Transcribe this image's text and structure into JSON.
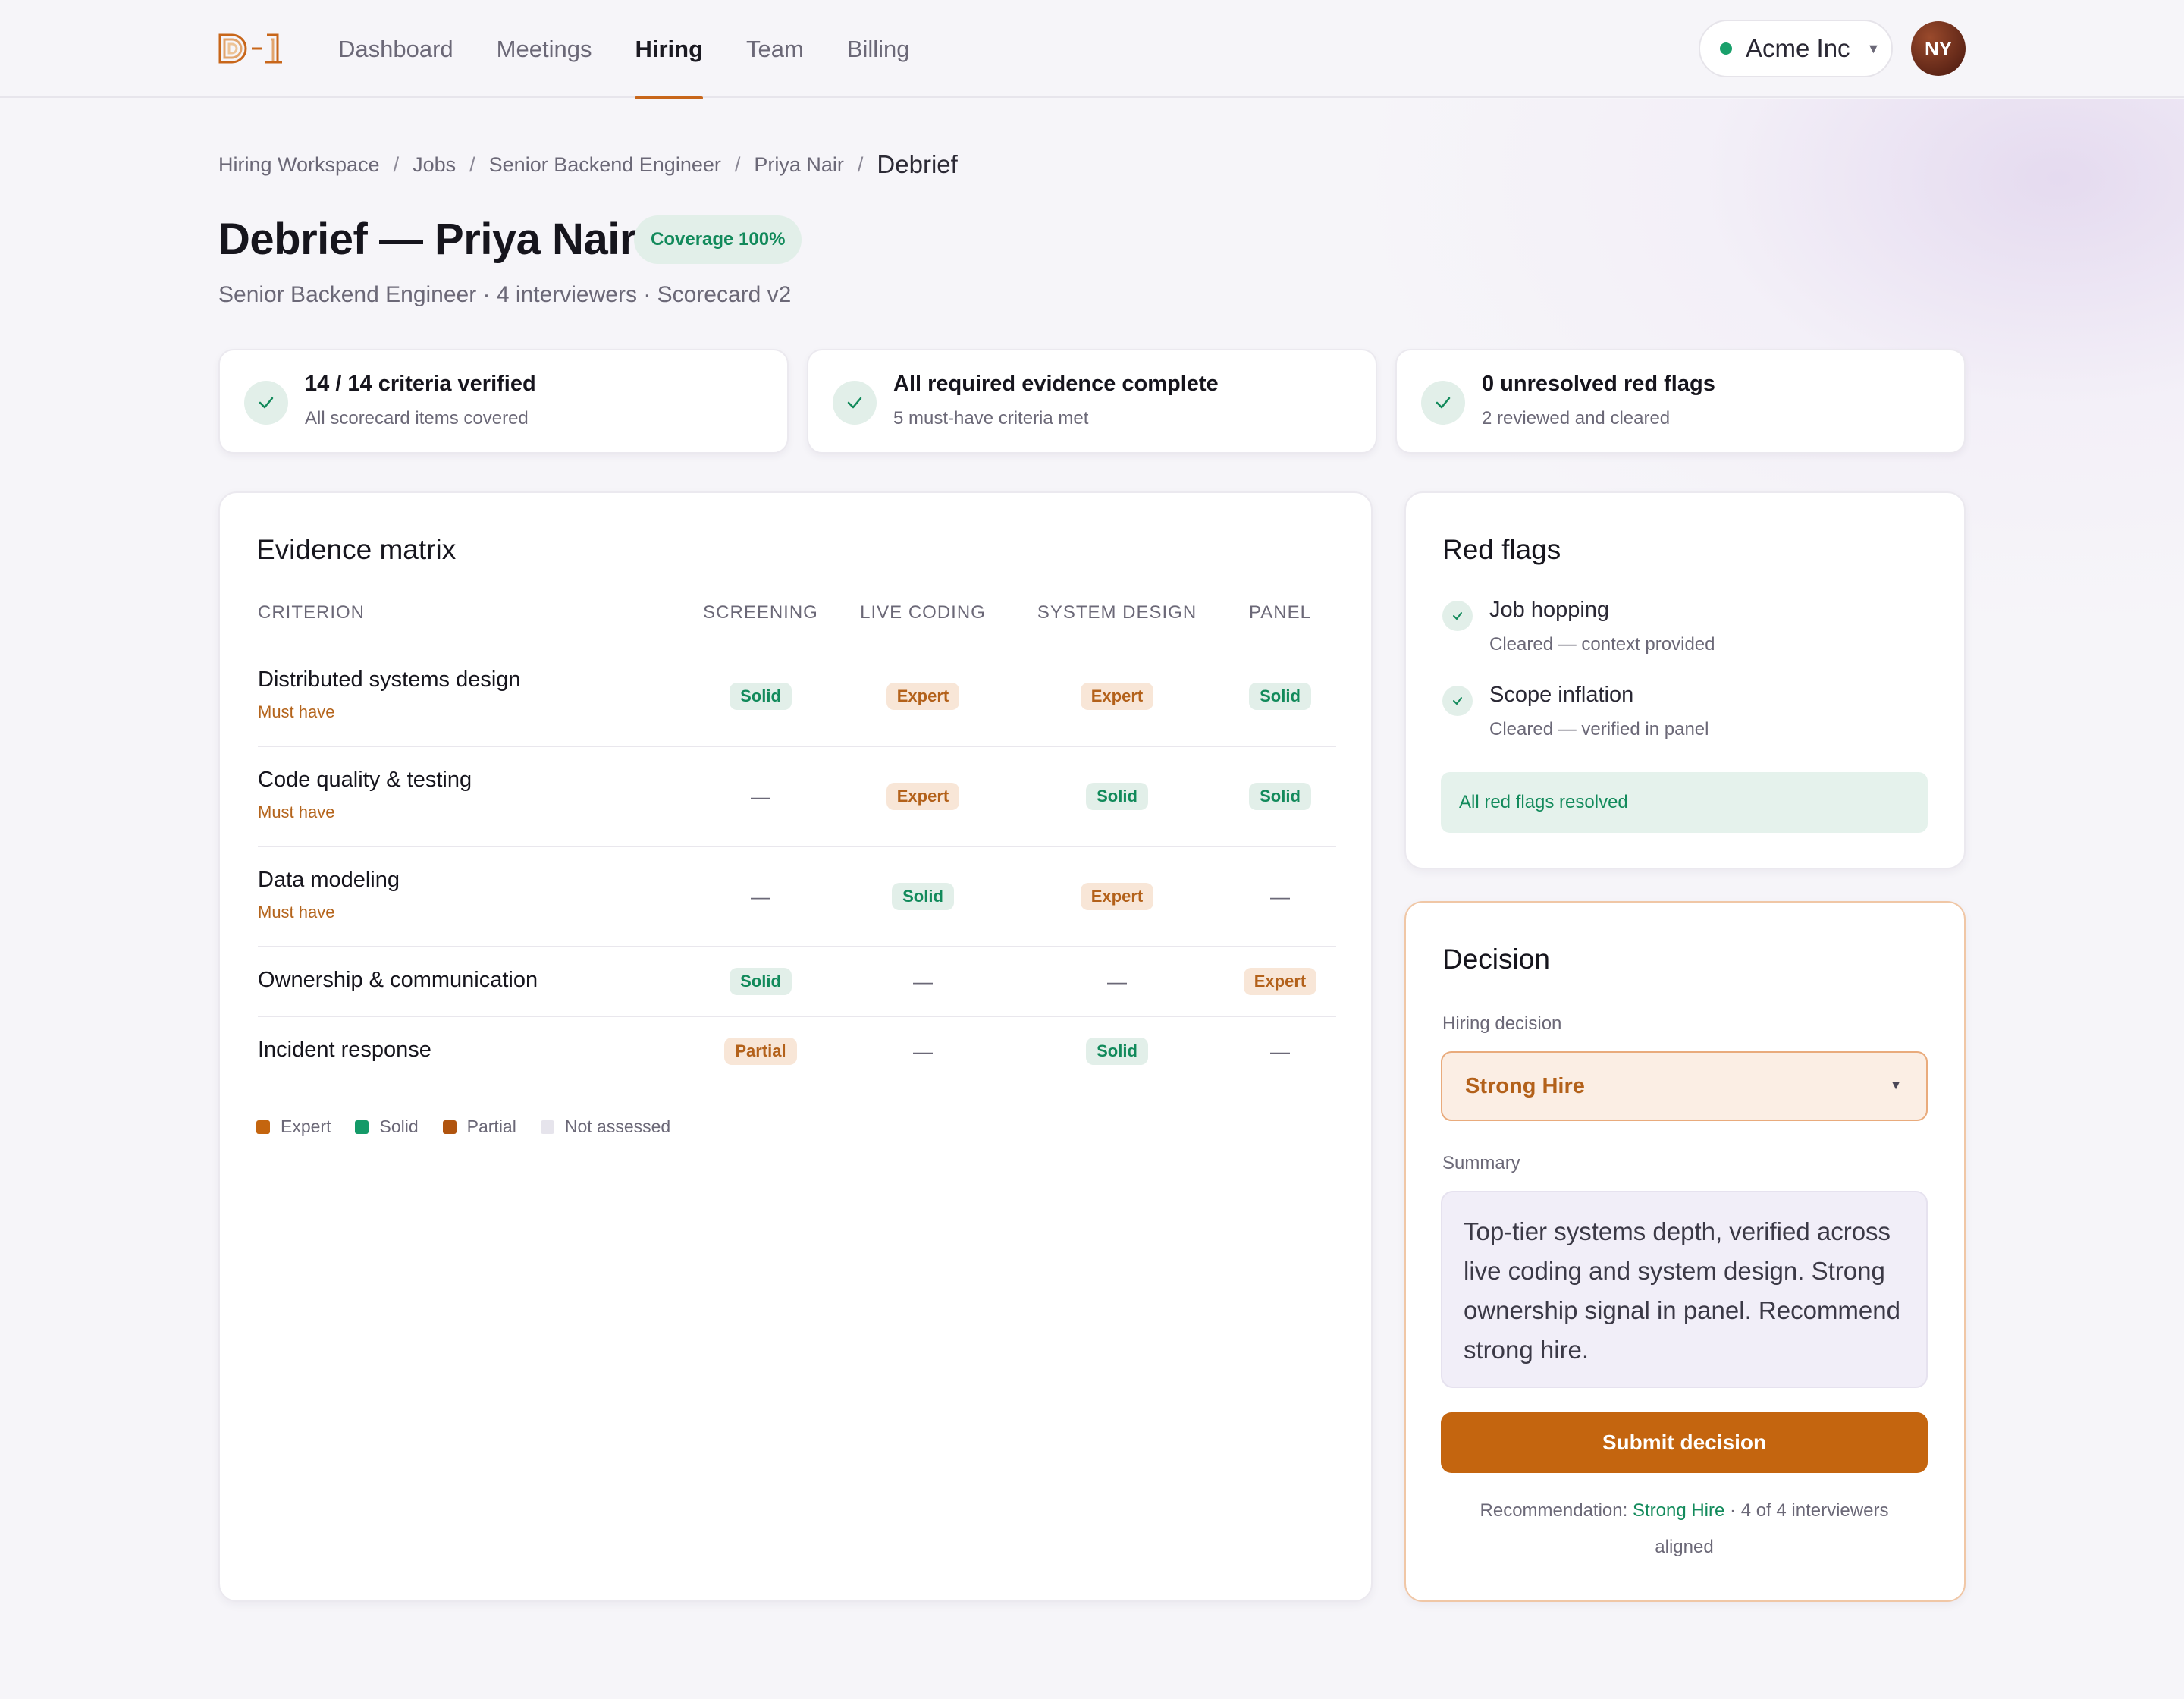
{
  "nav": {
    "logo": "D-1",
    "links": [
      "Dashboard",
      "Meetings",
      "Hiring",
      "Team",
      "Billing"
    ],
    "active": "Hiring",
    "org": "Acme Inc",
    "avatar_initials": "NY"
  },
  "breadcrumb": [
    "Hiring Workspace",
    "Jobs",
    "Senior Backend Engineer",
    "Priya Nair",
    "Debrief"
  ],
  "header": {
    "title": "Debrief — Priya Nair",
    "coverage_badge": "Coverage 100%",
    "subtitle": "Senior Backend Engineer · 4 interviewers · Scorecard v2"
  },
  "stats": [
    {
      "title": "14 / 14 criteria verified",
      "sub": "All scorecard items covered"
    },
    {
      "title": "All required evidence complete",
      "sub": "5 must-have criteria met"
    },
    {
      "title": "0 unresolved red flags",
      "sub": "2 reviewed and cleared"
    }
  ],
  "matrix": {
    "title": "Evidence matrix",
    "columns": [
      "CRITERION",
      "SCREENING",
      "LIVE CODING",
      "SYSTEM DESIGN",
      "PANEL"
    ],
    "rows": [
      {
        "name": "Distributed systems design",
        "sub": "Must have",
        "cells": [
          "Solid",
          "Expert",
          "Expert",
          "Solid"
        ]
      },
      {
        "name": "Code quality & testing",
        "sub": "Must have",
        "cells": [
          "—",
          "Expert",
          "Solid",
          "Solid"
        ]
      },
      {
        "name": "Data modeling",
        "sub": "Must have",
        "cells": [
          "—",
          "Solid",
          "Expert",
          "—"
        ]
      },
      {
        "name": "Ownership & communication",
        "sub": "",
        "cells": [
          "Solid",
          "—",
          "—",
          "Expert"
        ]
      },
      {
        "name": "Incident response",
        "sub": "",
        "cells": [
          "Partial",
          "—",
          "Solid",
          "—"
        ]
      }
    ],
    "legend": [
      {
        "label": "Expert",
        "color": "#c4650f"
      },
      {
        "label": "Solid",
        "color": "#149a68"
      },
      {
        "label": "Partial",
        "color": "#b0540f"
      },
      {
        "label": "Not assessed",
        "color": "#e6e4ec"
      }
    ]
  },
  "redflags": {
    "title": "Red flags",
    "items": [
      {
        "title": "Job hopping",
        "sub": "Cleared — context provided"
      },
      {
        "title": "Scope inflation",
        "sub": "Cleared — verified in panel"
      }
    ],
    "banner": "All red flags resolved"
  },
  "decision": {
    "title": "Decision",
    "decision_label": "Hiring decision",
    "decision_value": "Strong Hire",
    "summary_label": "Summary",
    "summary": "Top-tier systems depth, verified across live coding and system design. Strong ownership signal in panel. Recommend strong hire.",
    "submit": "Submit decision",
    "reco_prefix": "Recommendation: ",
    "reco_value": "Strong Hire",
    "reco_suffix": " · 4 of 4 interviewers aligned"
  },
  "colors": {
    "accent": "#c4650f",
    "success": "#128a5b"
  }
}
